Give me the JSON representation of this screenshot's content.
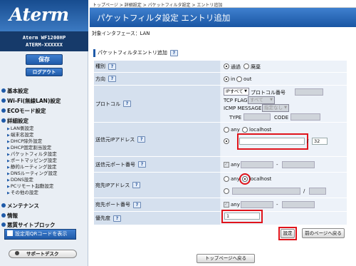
{
  "sidebar": {
    "logo": "Aterm",
    "model_line1": "Aterm WF1200HP",
    "model_line2": "ATERM-XXXXXX",
    "save_label": "保存",
    "logout_label": "ログアウト",
    "menu": {
      "basic": "基本設定",
      "wifi": "Wi-Fi(無線LAN)設定",
      "eco": "ECOモード設定",
      "detail": "詳細設定",
      "maintenance": "メンテナンス",
      "info": "情報",
      "malicious": "悪質サイトブロック"
    },
    "subitems": [
      "LAN側設定",
      "端末名設定",
      "DHCP除外設定",
      "DHCP固定割当設定",
      "パケットフィルタ設定",
      "ポートマッピング設定",
      "静的ルーティング設定",
      "DNSルーティング設定",
      "DDNS設定",
      "PCリモート起動設定",
      "その他の設定"
    ],
    "qr_label": "設定用QRコードを表示",
    "support_label": "サポートデスク"
  },
  "breadcrumb": {
    "top": "トップページ",
    "sep": ">",
    "detail": "詳細設定",
    "filter": "パケットフィルタ設定",
    "current": "エントリ追加"
  },
  "title": "パケットフィルタ設定 エントリ追加",
  "interface_label": "対象インタフェース：LAN",
  "section_title": "パケットフィルタエントリ追加",
  "help_text": "?",
  "form": {
    "type": {
      "label": "種別",
      "opt1": "通過",
      "opt2": "廃棄"
    },
    "direction": {
      "label": "方向",
      "opt1": "in",
      "opt2": "out"
    },
    "protocol": {
      "label": "プロトコル",
      "select": "IPすべて",
      "number_label": "プロトコル番号",
      "tcp_flag_label": "TCP FLAG",
      "tcp_flag_value": "すべて",
      "icmp_label": "ICMP MESSAGE",
      "icmp_value": "指定なし",
      "type_label": "TYPE",
      "code_label": "CODE"
    },
    "src_ip": {
      "label": "送信元IPアドレス",
      "any": "any",
      "localhost": "localhost",
      "slash": "/",
      "mask": "32",
      "address": ""
    },
    "src_port": {
      "label": "送信元ポート番号",
      "any": "any",
      "dash": "-"
    },
    "dst_ip": {
      "label": "宛先IPアドレス",
      "any": "any",
      "localhost": "localhost",
      "slash": "/"
    },
    "dst_port": {
      "label": "宛先ポート番号",
      "any": "any",
      "dash": "-"
    },
    "priority": {
      "label": "優先度",
      "value": "1"
    }
  },
  "buttons": {
    "set": "設定",
    "back": "前のページへ戻る",
    "top": "トップページへ戻る"
  },
  "colors": {
    "accent": "#1f5aa8",
    "highlight": "#e0141b"
  }
}
